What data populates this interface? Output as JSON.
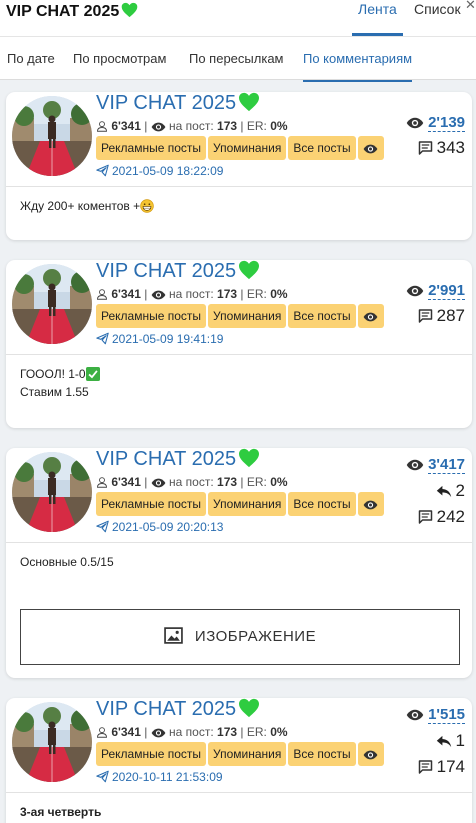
{
  "app": {
    "title": "VIP CHAT 2025",
    "close": "✕"
  },
  "view_tabs": [
    {
      "label": "Лента",
      "active": true
    },
    {
      "label": "Список",
      "active": false
    }
  ],
  "sort_tabs": [
    {
      "label": "По дате",
      "active": false
    },
    {
      "label": "По просмотрам",
      "active": false
    },
    {
      "label": "По пересылкам",
      "active": false
    },
    {
      "label": "По комментариям",
      "active": true
    }
  ],
  "common": {
    "channel_name": "VIP CHAT 2025",
    "subscribers": "6'341",
    "reach_label": "на пост:",
    "reach_value": "173",
    "er_label": "ER:",
    "er_value": "0%",
    "btn_ads": "Рекламные посты",
    "btn_mentions": "Упоминания",
    "btn_all": "Все посты"
  },
  "posts": [
    {
      "views": "2'139",
      "comments": "343",
      "timestamp": "2021-05-09 18:22:09",
      "lines": [
        "Жду 200+ коментов +"
      ]
    },
    {
      "views": "2'991",
      "comments": "287",
      "timestamp": "2021-05-09 19:41:19",
      "lines": [
        "ГОООЛ! 1-0",
        "Ставим 1.55"
      ]
    },
    {
      "views": "3'417",
      "forwards": "2",
      "comments": "242",
      "timestamp": "2021-05-09 20:20:13",
      "lines": [
        "Основные 0.5/15"
      ],
      "image_label": "ИЗОБРАЖЕНИЕ"
    },
    {
      "views": "1'515",
      "forwards": "1",
      "comments": "174",
      "timestamp": "2020-10-11 21:53:09",
      "lines": [
        "3-ая четверть"
      ]
    }
  ],
  "colors": {
    "accent": "#2a6db0",
    "button": "#fbd274",
    "heart": "#2ecc40",
    "check": "#3cb043"
  }
}
